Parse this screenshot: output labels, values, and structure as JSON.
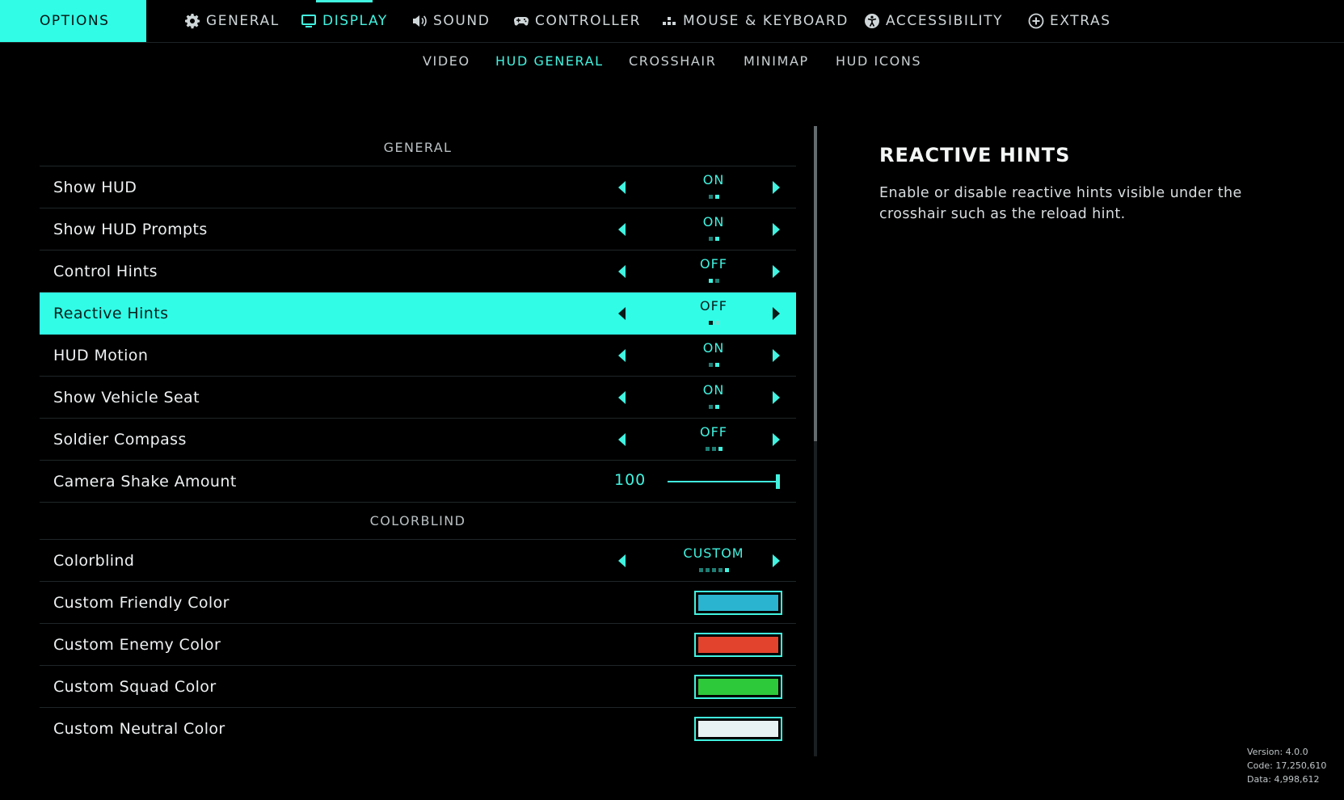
{
  "colors": {
    "accent": "#41f3e0",
    "highlight": "#31fde7",
    "background": "#000000"
  },
  "header": {
    "options_label": "OPTIONS",
    "tabs": [
      {
        "label": "GENERAL",
        "icon": "gear-icon"
      },
      {
        "label": "DISPLAY",
        "icon": "monitor-icon",
        "active": true
      },
      {
        "label": "SOUND",
        "icon": "speaker-icon"
      },
      {
        "label": "CONTROLLER",
        "icon": "gamepad-icon"
      },
      {
        "label": "MOUSE & KEYBOARD",
        "icon": "mouse-keyboard-icon"
      },
      {
        "label": "ACCESSIBILITY",
        "icon": "accessibility-icon"
      },
      {
        "label": "EXTRAS",
        "icon": "plus-circle-icon"
      }
    ]
  },
  "subnav": {
    "tabs": [
      {
        "label": "VIDEO"
      },
      {
        "label": "HUD GENERAL",
        "active": true
      },
      {
        "label": "CROSSHAIR"
      },
      {
        "label": "MINIMAP"
      },
      {
        "label": "HUD ICONS"
      }
    ]
  },
  "sections": {
    "general": {
      "title": "GENERAL",
      "rows": [
        {
          "label": "Show HUD",
          "value": "ON",
          "option_count": 2,
          "selected_index": 1
        },
        {
          "label": "Show HUD Prompts",
          "value": "ON",
          "option_count": 2,
          "selected_index": 1
        },
        {
          "label": "Control Hints",
          "value": "OFF",
          "option_count": 2,
          "selected_index": 0
        },
        {
          "label": "Reactive Hints",
          "value": "OFF",
          "option_count": 2,
          "selected_index": 0,
          "selected": true
        },
        {
          "label": "HUD Motion",
          "value": "ON",
          "option_count": 2,
          "selected_index": 1
        },
        {
          "label": "Show Vehicle Seat",
          "value": "ON",
          "option_count": 2,
          "selected_index": 1
        },
        {
          "label": "Soldier Compass",
          "value": "OFF",
          "option_count": 3,
          "selected_index": 2
        }
      ],
      "slider": {
        "label": "Camera Shake Amount",
        "value": "100",
        "fraction": 1.0
      }
    },
    "colorblind": {
      "title": "COLORBLIND",
      "selector": {
        "label": "Colorblind",
        "value": "CUSTOM",
        "option_count": 5,
        "selected_index": 4
      },
      "swatches": [
        {
          "label": "Custom Friendly Color",
          "color": "#2bb4cf"
        },
        {
          "label": "Custom Enemy Color",
          "color": "#e2432c"
        },
        {
          "label": "Custom Squad Color",
          "color": "#2ec93a"
        },
        {
          "label": "Custom Neutral Color",
          "color": "#e7f3f3"
        }
      ]
    }
  },
  "description": {
    "title": "REACTIVE HINTS",
    "text": "Enable or disable reactive hints visible under the crosshair such as the reload hint."
  },
  "version": {
    "version": "Version: 4.0.0",
    "code": "Code: 17,250,610",
    "data": "Data: 4,998,612"
  }
}
